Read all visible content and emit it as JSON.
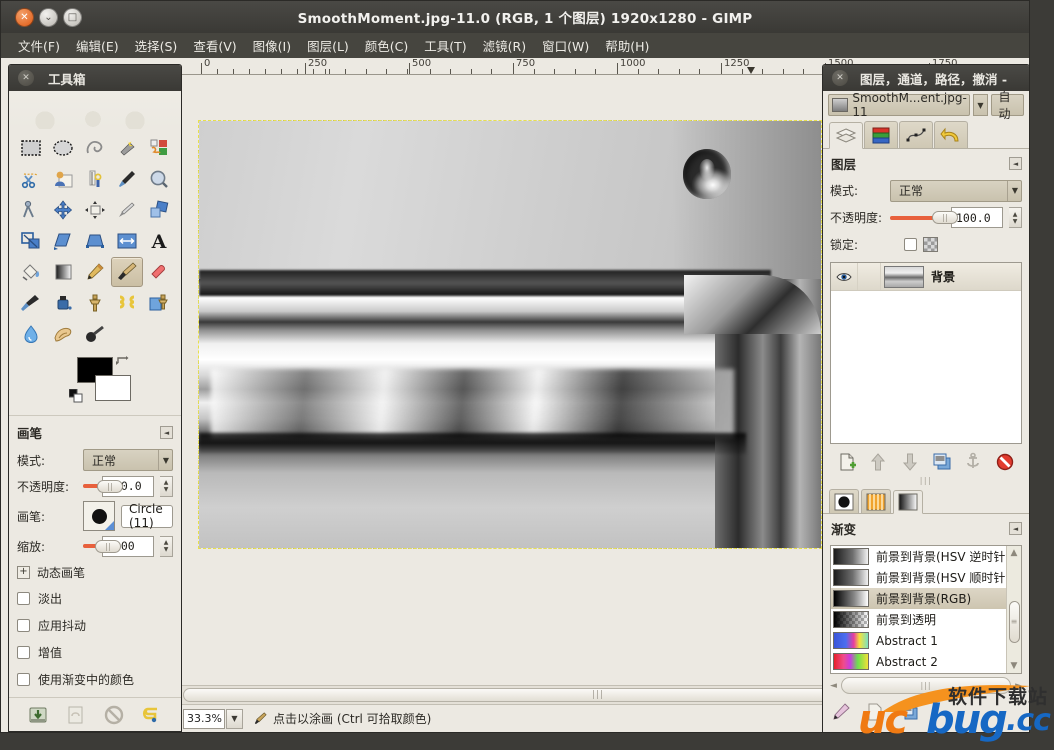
{
  "window": {
    "title": "SmoothMoment.jpg-11.0 (RGB, 1 个图层) 1920x1280 - GIMP",
    "close_glyph": "✕",
    "min_glyph": "⌄",
    "max_glyph": "□"
  },
  "menubar": {
    "items": [
      "文件(F)",
      "编辑(E)",
      "选择(S)",
      "查看(V)",
      "图像(I)",
      "图层(L)",
      "颜色(C)",
      "工具(T)",
      "滤镜(R)",
      "窗口(W)",
      "帮助(H)"
    ]
  },
  "ruler": {
    "labels": [
      "0",
      "250",
      "500",
      "750",
      "1000",
      "1250",
      "1500",
      "1750"
    ],
    "marker_position": "1250"
  },
  "statusbar": {
    "zoom": "33.3%",
    "zoom_dropdown_glyph": "▼",
    "message": "点击以涂画 (Ctrl 可拾取颜色)"
  },
  "toolbox": {
    "title": "工具箱",
    "close_glyph": "✕",
    "tools": [
      {
        "name": "rect-select-tool",
        "label": "矩形选择"
      },
      {
        "name": "ellipse-select-tool",
        "label": "椭圆选择"
      },
      {
        "name": "free-select-tool",
        "label": "自由选择"
      },
      {
        "name": "fuzzy-select-tool",
        "label": "模糊选择"
      },
      {
        "name": "by-color-select-tool",
        "label": "按颜色选择"
      },
      {
        "name": "scissors-select-tool",
        "label": "智能剪刀"
      },
      {
        "name": "foreground-select-tool",
        "label": "前景选择"
      },
      {
        "name": "paths-tool",
        "label": "路径"
      },
      {
        "name": "color-picker-tool",
        "label": "拾色器"
      },
      {
        "name": "zoom-tool",
        "label": "缩放"
      },
      {
        "name": "measure-tool",
        "label": "测量"
      },
      {
        "name": "move-tool",
        "label": "移动"
      },
      {
        "name": "align-tool",
        "label": "对齐"
      },
      {
        "name": "crop-tool",
        "label": "裁剪"
      },
      {
        "name": "rotate-tool",
        "label": "旋转"
      },
      {
        "name": "scale-tool",
        "label": "缩放变换"
      },
      {
        "name": "shear-tool",
        "label": "切变"
      },
      {
        "name": "perspective-tool",
        "label": "透视"
      },
      {
        "name": "flip-tool",
        "label": "翻转"
      },
      {
        "name": "text-tool",
        "label": "文字"
      },
      {
        "name": "bucket-fill-tool",
        "label": "油漆桶填充"
      },
      {
        "name": "gradient-tool",
        "label": "渐变"
      },
      {
        "name": "pencil-tool",
        "label": "铅笔"
      },
      {
        "name": "paintbrush-tool",
        "label": "画笔",
        "active": true
      },
      {
        "name": "eraser-tool",
        "label": "橡皮擦"
      },
      {
        "name": "airbrush-tool",
        "label": "喷枪"
      },
      {
        "name": "ink-tool",
        "label": "墨水"
      },
      {
        "name": "clone-tool",
        "label": "仿制"
      },
      {
        "name": "heal-tool",
        "label": "修复"
      },
      {
        "name": "perspective-clone-tool",
        "label": "透视仿制"
      },
      {
        "name": "blur-sharpen-tool",
        "label": "模糊/锐化"
      },
      {
        "name": "smudge-tool",
        "label": "涂抹"
      },
      {
        "name": "dodge-burn-tool",
        "label": "减淡/加深"
      }
    ],
    "foreground_color": "#000000",
    "background_color": "#ffffff",
    "options": {
      "header": "画笔",
      "mode_label": "模式:",
      "mode_value": "正常",
      "opacity_label": "不透明度:",
      "opacity_value": "100.0",
      "brush_label": "画笔:",
      "brush_value": "Circle (11)",
      "scale_label": "缩放:",
      "scale_value": "1.00",
      "dynamics_label": "动态画笔",
      "dynamics_glyph": "+",
      "checkboxes": [
        {
          "label": "淡出",
          "checked": false
        },
        {
          "label": "应用抖动",
          "checked": false
        },
        {
          "label": "增值",
          "checked": false
        },
        {
          "label": "使用渐变中的颜色",
          "checked": false
        }
      ]
    },
    "bottom_buttons": [
      {
        "name": "save-tool-options-button"
      },
      {
        "name": "restore-tool-options-button"
      },
      {
        "name": "delete-tool-options-button"
      },
      {
        "name": "reset-tool-options-button"
      }
    ]
  },
  "dock": {
    "title": "图层，通道，路径，撤消 -",
    "close_glyph": "✕",
    "image_name": "SmoothM...ent.jpg-11",
    "image_drop_glyph": "▼",
    "auto_label": "自动",
    "tabs": [
      {
        "name": "tab-layers",
        "label": "图层",
        "active": true
      },
      {
        "name": "tab-channels",
        "label": "通道",
        "active": false
      },
      {
        "name": "tab-paths",
        "label": "路径",
        "active": false
      },
      {
        "name": "tab-undo",
        "label": "撤消",
        "active": false
      }
    ],
    "layers_panel": {
      "header": "图层",
      "mode_label": "模式:",
      "mode_value": "正常",
      "opacity_label": "不透明度:",
      "opacity_value": "100.0",
      "lock_label": "锁定:",
      "layers": [
        {
          "name": "背景",
          "visible": true,
          "selected": true
        }
      ],
      "buttons": [
        {
          "name": "new-layer-button"
        },
        {
          "name": "raise-layer-button"
        },
        {
          "name": "lower-layer-button"
        },
        {
          "name": "duplicate-layer-button"
        },
        {
          "name": "anchor-layer-button"
        },
        {
          "name": "delete-layer-button"
        }
      ]
    },
    "resource_tabs": [
      {
        "name": "tab-brushes",
        "active": false
      },
      {
        "name": "tab-patterns",
        "active": false
      },
      {
        "name": "tab-gradients",
        "active": true
      }
    ],
    "gradients_panel": {
      "header": "渐变",
      "items": [
        {
          "name": "前景到背景(HSV 逆时针色调)",
          "selected": false,
          "swatch": "gray-dark-to-light"
        },
        {
          "name": "前景到背景(HSV 顺时针色调)",
          "selected": false,
          "swatch": "gray-dark-to-light"
        },
        {
          "name": "前景到背景(RGB)",
          "selected": true,
          "swatch": "black-to-white"
        },
        {
          "name": "前景到透明",
          "selected": false,
          "swatch": "black-to-transparent"
        },
        {
          "name": "Abstract 1",
          "selected": false,
          "swatch": "abstract1"
        },
        {
          "name": "Abstract 2",
          "selected": false,
          "swatch": "abstract2"
        }
      ],
      "buttons": [
        {
          "name": "edit-gradient-button"
        },
        {
          "name": "new-gradient-button"
        },
        {
          "name": "duplicate-gradient-button"
        }
      ]
    }
  },
  "watermark": {
    "chinese": "软件下载站",
    "uc": "uc",
    "bug": "bug",
    "cc": ".cc"
  },
  "colors": {
    "accent_orange": "#e8603c",
    "titlebar_dark": "#3e3d39",
    "panel_bg": "#ece9e2",
    "close_button": "#df5a13"
  }
}
